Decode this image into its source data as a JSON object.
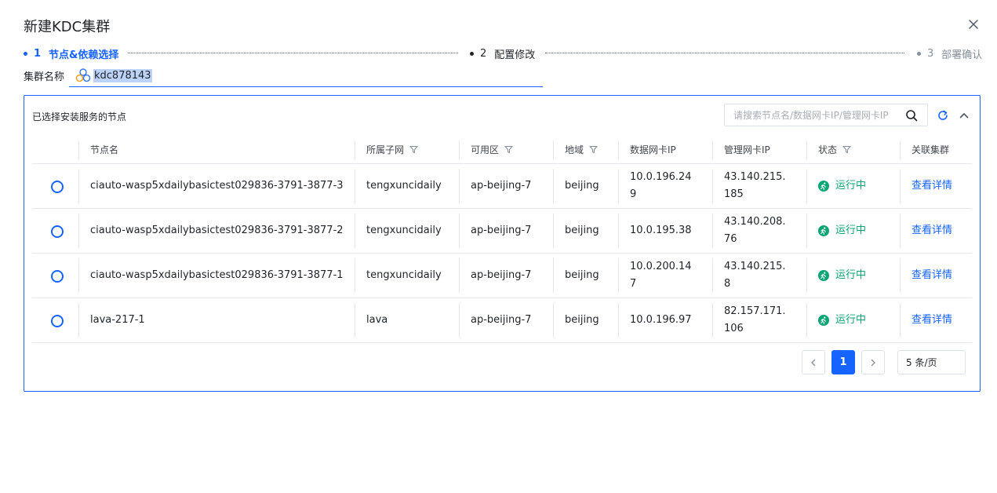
{
  "dialog": {
    "title": "新建KDC集群"
  },
  "steps": [
    {
      "num": "1",
      "label": "节点&依赖选择"
    },
    {
      "num": "2",
      "label": "配置修改"
    },
    {
      "num": "3",
      "label": "部署确认"
    }
  ],
  "cluster": {
    "label": "集群名称",
    "value": "kdc878143"
  },
  "panel": {
    "title": "已选择安装服务的节点",
    "search_placeholder": "请搜索节点名/数据网卡IP/管理网卡IP"
  },
  "table": {
    "columns": [
      "节点名",
      "所属子网",
      "可用区",
      "地域",
      "数据网卡IP",
      "管理网卡IP",
      "状态",
      "关联集群"
    ],
    "rows": [
      {
        "name": "ciauto-wasp5xdailybasictest029836-3791-3877-3",
        "subnet": "tengxuncidaily",
        "zone": "ap-beijing-7",
        "region": "beijing",
        "data_ip": "10.0.196.249",
        "mgmt_ip": "43.140.215.185",
        "status": "运行中",
        "link": "查看详情"
      },
      {
        "name": "ciauto-wasp5xdailybasictest029836-3791-3877-2",
        "subnet": "tengxuncidaily",
        "zone": "ap-beijing-7",
        "region": "beijing",
        "data_ip": "10.0.195.38",
        "mgmt_ip": "43.140.208.76",
        "status": "运行中",
        "link": "查看详情"
      },
      {
        "name": "ciauto-wasp5xdailybasictest029836-3791-3877-1",
        "subnet": "tengxuncidaily",
        "zone": "ap-beijing-7",
        "region": "beijing",
        "data_ip": "10.0.200.147",
        "mgmt_ip": "43.140.215.8",
        "status": "运行中",
        "link": "查看详情"
      },
      {
        "name": "lava-217-1",
        "subnet": "lava",
        "zone": "ap-beijing-7",
        "region": "beijing",
        "data_ip": "10.0.196.97",
        "mgmt_ip": "82.157.171.106",
        "status": "运行中",
        "link": "查看详情"
      }
    ]
  },
  "pagination": {
    "current": "1",
    "page_size": "5 条/页"
  },
  "colors": {
    "accent": "#1664ff",
    "status_running": "#0aa574"
  },
  "icons": [
    "close-icon",
    "cluster-icon",
    "search-icon",
    "refresh-icon",
    "chevron-up-icon",
    "filter-icon",
    "running-icon",
    "chevron-left-icon",
    "chevron-right-icon"
  ]
}
